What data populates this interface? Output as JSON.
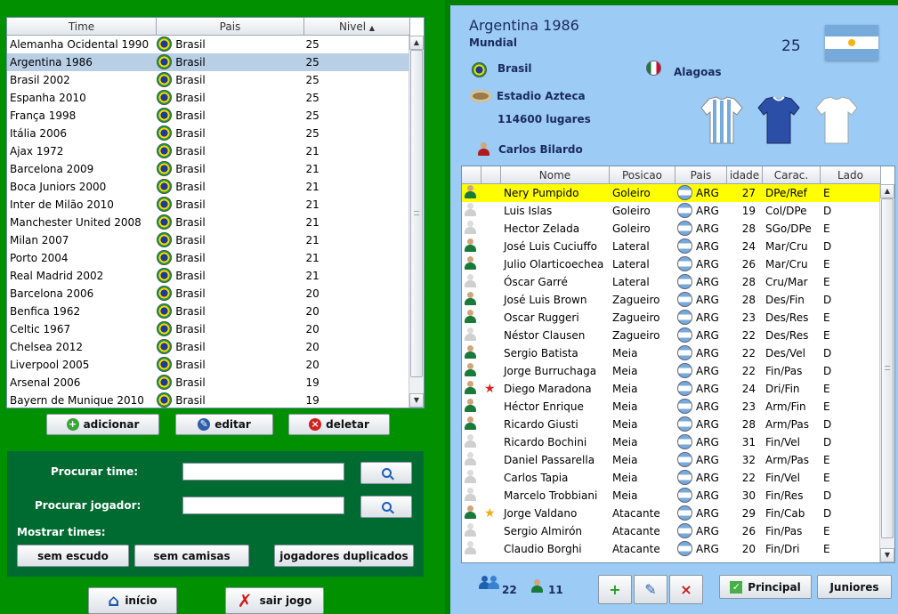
{
  "teams_table": {
    "columns": [
      "Time",
      "Pais",
      "Nivel"
    ],
    "rows": [
      {
        "time": "Alemanha Ocidental 1990",
        "pais": "Brasil",
        "nivel": "25"
      },
      {
        "time": "Argentina 1986",
        "pais": "Brasil",
        "nivel": "25",
        "selected": true
      },
      {
        "time": "Brasil 2002",
        "pais": "Brasil",
        "nivel": "25"
      },
      {
        "time": "Espanha 2010",
        "pais": "Brasil",
        "nivel": "25"
      },
      {
        "time": "França 1998",
        "pais": "Brasil",
        "nivel": "25"
      },
      {
        "time": "Itália 2006",
        "pais": "Brasil",
        "nivel": "25"
      },
      {
        "time": "Ajax 1972",
        "pais": "Brasil",
        "nivel": "21"
      },
      {
        "time": "Barcelona 2009",
        "pais": "Brasil",
        "nivel": "21"
      },
      {
        "time": "Boca Juniors 2000",
        "pais": "Brasil",
        "nivel": "21"
      },
      {
        "time": "Inter de Milão 2010",
        "pais": "Brasil",
        "nivel": "21"
      },
      {
        "time": "Manchester United 2008",
        "pais": "Brasil",
        "nivel": "21"
      },
      {
        "time": "Milan 2007",
        "pais": "Brasil",
        "nivel": "21"
      },
      {
        "time": "Porto 2004",
        "pais": "Brasil",
        "nivel": "21"
      },
      {
        "time": "Real Madrid 2002",
        "pais": "Brasil",
        "nivel": "21"
      },
      {
        "time": "Barcelona 2006",
        "pais": "Brasil",
        "nivel": "20"
      },
      {
        "time": "Benfica 1962",
        "pais": "Brasil",
        "nivel": "20"
      },
      {
        "time": "Celtic 1967",
        "pais": "Brasil",
        "nivel": "20"
      },
      {
        "time": "Chelsea 2012",
        "pais": "Brasil",
        "nivel": "20"
      },
      {
        "time": "Liverpool 2005",
        "pais": "Brasil",
        "nivel": "20"
      },
      {
        "time": "Arsenal 2006",
        "pais": "Brasil",
        "nivel": "19"
      },
      {
        "time": "Bayern de Munique 2010",
        "pais": "Brasil",
        "nivel": "19"
      }
    ]
  },
  "team_actions": {
    "add": "adicionar",
    "edit": "editar",
    "delete": "deletar"
  },
  "search": {
    "team_label": "Procurar time:",
    "player_label": "Procurar jogador:",
    "team_value": "",
    "player_value": "",
    "show_label": "Mostrar times:",
    "no_badge": "sem escudo",
    "no_shirts": "sem camisas",
    "duplicate_players": "jogadores duplicados"
  },
  "nav": {
    "home": "início",
    "exit": "sair jogo"
  },
  "team_detail": {
    "name": "Argentina 1986",
    "competition": "Mundial",
    "level": "25",
    "country": "Brasil",
    "state": "Alagoas",
    "stadium": "Estadio Azteca",
    "capacity": "114600 lugares",
    "coach": "Carlos Bilardo"
  },
  "players_table": {
    "columns": [
      "",
      "",
      "Nome",
      "Posicao",
      "Pais",
      "idade",
      "Carac.",
      "Lado"
    ],
    "rows": [
      {
        "nome": "Nery Pumpido",
        "posicao": "Goleiro",
        "pais": "ARG",
        "idade": "27",
        "carac": "DPe/Ref",
        "lado": "E",
        "starter": true,
        "highlight": true,
        "star": ""
      },
      {
        "nome": "Luis Islas",
        "posicao": "Goleiro",
        "pais": "ARG",
        "idade": "19",
        "carac": "Col/DPe",
        "lado": "D",
        "starter": false,
        "star": ""
      },
      {
        "nome": "Hector Zelada",
        "posicao": "Goleiro",
        "pais": "ARG",
        "idade": "28",
        "carac": "SGo/DPe",
        "lado": "E",
        "starter": false,
        "star": ""
      },
      {
        "nome": "José Luis Cuciuffo",
        "posicao": "Lateral",
        "pais": "ARG",
        "idade": "24",
        "carac": "Mar/Cru",
        "lado": "D",
        "starter": true,
        "star": ""
      },
      {
        "nome": "Julio Olarticoechea",
        "posicao": "Lateral",
        "pais": "ARG",
        "idade": "26",
        "carac": "Mar/Cru",
        "lado": "E",
        "starter": true,
        "star": ""
      },
      {
        "nome": "Óscar Garré",
        "posicao": "Lateral",
        "pais": "ARG",
        "idade": "28",
        "carac": "Cru/Mar",
        "lado": "E",
        "starter": false,
        "star": ""
      },
      {
        "nome": "José Luis Brown",
        "posicao": "Zagueiro",
        "pais": "ARG",
        "idade": "28",
        "carac": "Des/Fin",
        "lado": "D",
        "starter": true,
        "star": ""
      },
      {
        "nome": "Oscar Ruggeri",
        "posicao": "Zagueiro",
        "pais": "ARG",
        "idade": "23",
        "carac": "Des/Res",
        "lado": "E",
        "starter": true,
        "star": ""
      },
      {
        "nome": "Néstor Clausen",
        "posicao": "Zagueiro",
        "pais": "ARG",
        "idade": "22",
        "carac": "Des/Res",
        "lado": "E",
        "starter": false,
        "star": ""
      },
      {
        "nome": "Sergio Batista",
        "posicao": "Meia",
        "pais": "ARG",
        "idade": "22",
        "carac": "Des/Vel",
        "lado": "D",
        "starter": true,
        "star": ""
      },
      {
        "nome": "Jorge Burruchaga",
        "posicao": "Meia",
        "pais": "ARG",
        "idade": "22",
        "carac": "Fin/Pas",
        "lado": "D",
        "starter": true,
        "star": ""
      },
      {
        "nome": "Diego Maradona",
        "posicao": "Meia",
        "pais": "ARG",
        "idade": "24",
        "carac": "Dri/Fin",
        "lado": "E",
        "starter": true,
        "star": "red"
      },
      {
        "nome": "Héctor Enrique",
        "posicao": "Meia",
        "pais": "ARG",
        "idade": "23",
        "carac": "Arm/Fin",
        "lado": "E",
        "starter": true,
        "star": ""
      },
      {
        "nome": "Ricardo Giusti",
        "posicao": "Meia",
        "pais": "ARG",
        "idade": "28",
        "carac": "Arm/Pas",
        "lado": "D",
        "starter": true,
        "star": ""
      },
      {
        "nome": "Ricardo Bochini",
        "posicao": "Meia",
        "pais": "ARG",
        "idade": "31",
        "carac": "Fin/Vel",
        "lado": "D",
        "starter": false,
        "star": ""
      },
      {
        "nome": "Daniel Passarella",
        "posicao": "Meia",
        "pais": "ARG",
        "idade": "32",
        "carac": "Arm/Pas",
        "lado": "E",
        "starter": false,
        "star": ""
      },
      {
        "nome": "Carlos Tapia",
        "posicao": "Meia",
        "pais": "ARG",
        "idade": "22",
        "carac": "Fin/Vel",
        "lado": "E",
        "starter": false,
        "star": ""
      },
      {
        "nome": "Marcelo Trobbiani",
        "posicao": "Meia",
        "pais": "ARG",
        "idade": "30",
        "carac": "Fin/Res",
        "lado": "D",
        "starter": false,
        "star": ""
      },
      {
        "nome": "Jorge Valdano",
        "posicao": "Atacante",
        "pais": "ARG",
        "idade": "29",
        "carac": "Fin/Cab",
        "lado": "D",
        "starter": true,
        "star": "gold"
      },
      {
        "nome": "Sergio Almirón",
        "posicao": "Atacante",
        "pais": "ARG",
        "idade": "26",
        "carac": "Fin/Pas",
        "lado": "E",
        "starter": false,
        "star": ""
      },
      {
        "nome": "Claudio Borghi",
        "posicao": "Atacante",
        "pais": "ARG",
        "idade": "20",
        "carac": "Fin/Dri",
        "lado": "E",
        "starter": false,
        "star": ""
      }
    ]
  },
  "squad_stats": {
    "total_players": "22",
    "starters": "11"
  },
  "player_actions": {
    "principal": "Principal",
    "juniores": "Juniores"
  },
  "colors": {
    "left_bg": "#009000",
    "right_bg": "#9ccbf6",
    "panel_dark": "#006b30",
    "selection": "#b8cfe6",
    "highlight": "#ffff00"
  },
  "icons": {
    "add": "plus-icon",
    "edit": "pencil-icon",
    "delete": "delete-x-icon",
    "search": "magnifier-icon",
    "home": "house-icon",
    "exit": "red-x-icon",
    "star_red": "red-star-icon",
    "star_gold": "gold-star-icon"
  }
}
